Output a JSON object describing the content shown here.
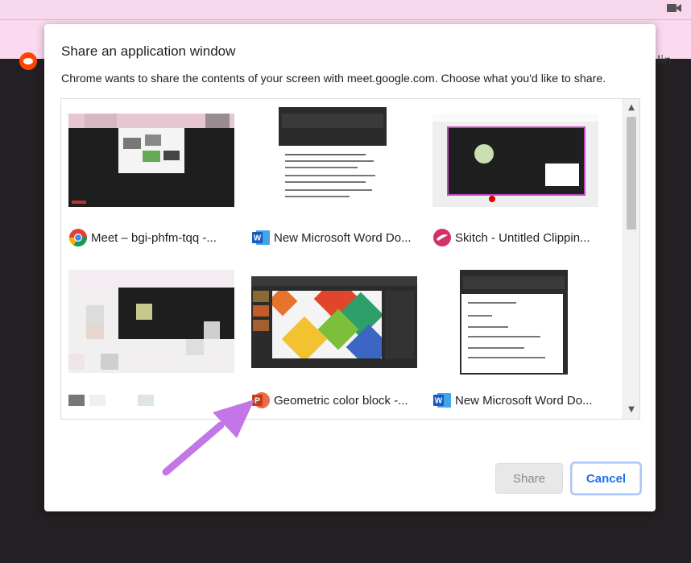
{
  "dialog": {
    "title": "Share an application window",
    "description": "Chrome wants to share the contents of your screen with meet.google.com. Choose what you'd like to share."
  },
  "windows": [
    {
      "label": "Meet – bgi-phfm-tqq -...",
      "icon": "chrome-icon"
    },
    {
      "label": "New Microsoft Word Do...",
      "icon": "word-icon"
    },
    {
      "label": "Skitch - Untitled Clippin...",
      "icon": "skitch-icon"
    },
    {
      "label": "",
      "icon": "blurred-window-icon"
    },
    {
      "label": "Geometric color block -...",
      "icon": "powerpoint-icon"
    },
    {
      "label": "New Microsoft Word Do...",
      "icon": "word-icon"
    }
  ],
  "buttons": {
    "share": "Share",
    "cancel": "Cancel"
  },
  "icon_letters": {
    "word": "W",
    "powerpoint": "P"
  },
  "colors": {
    "accent": "#1a73e8",
    "annotation_arrow": "#c476e8",
    "chrome_bar": "#fbd9ef"
  }
}
